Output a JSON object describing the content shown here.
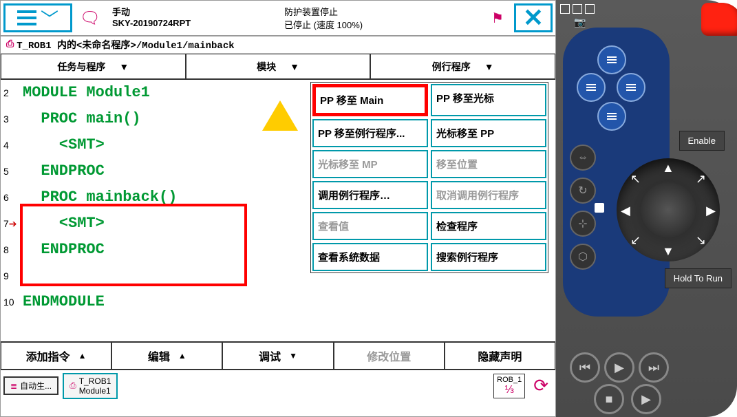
{
  "topbar": {
    "mode": "手动",
    "controller": "SKY-20190724RPT",
    "guard_status": "防护装置停止",
    "run_status": "已停止 (速度 100%)"
  },
  "breadcrumb": "T_ROB1 内的<未命名程序>/Module1/mainback",
  "header_tabs": {
    "task": "任务与程序",
    "module": "模块",
    "routine": "例行程序"
  },
  "code": {
    "line_numbers": [
      "2",
      "3",
      "4",
      "5",
      "6",
      "7",
      "8",
      "9",
      "10"
    ],
    "pointer_row": "7",
    "lines": [
      "MODULE Module1",
      "  PROC main()",
      "    <SMT>",
      "  ENDPROC",
      "  PROC mainback()",
      "    <SMT>",
      "  ENDPROC",
      "",
      "ENDMODULE"
    ]
  },
  "debug_menu": {
    "pp_to_main": "PP 移至 Main",
    "pp_to_cursor": "PP 移至光标",
    "pp_to_routine": "PP 移至例行程序...",
    "cursor_to_pp": "光标移至 PP",
    "cursor_to_mp": "光标移至 MP",
    "move_to_pos": "移至位置",
    "call_routine": "调用例行程序…",
    "cancel_call": "取消调用例行程序",
    "view_value": "查看值",
    "check_program": "检查程序",
    "view_sysdata": "查看系统数据",
    "search_routine": "搜索例行程序"
  },
  "bottom_tabs": {
    "add_instr": "添加指令",
    "edit": "编辑",
    "debug": "调试",
    "modify_pos": "修改位置",
    "hide_decl": "隐藏声明"
  },
  "taskbar": {
    "auto": "自动生...",
    "task1_line1": "T_ROB1",
    "task1_line2": "Module1",
    "rob_label": "ROB_1",
    "fraction": "⅓"
  },
  "hardware": {
    "enable_label": "Enable",
    "hold_label": "Hold To Run"
  }
}
